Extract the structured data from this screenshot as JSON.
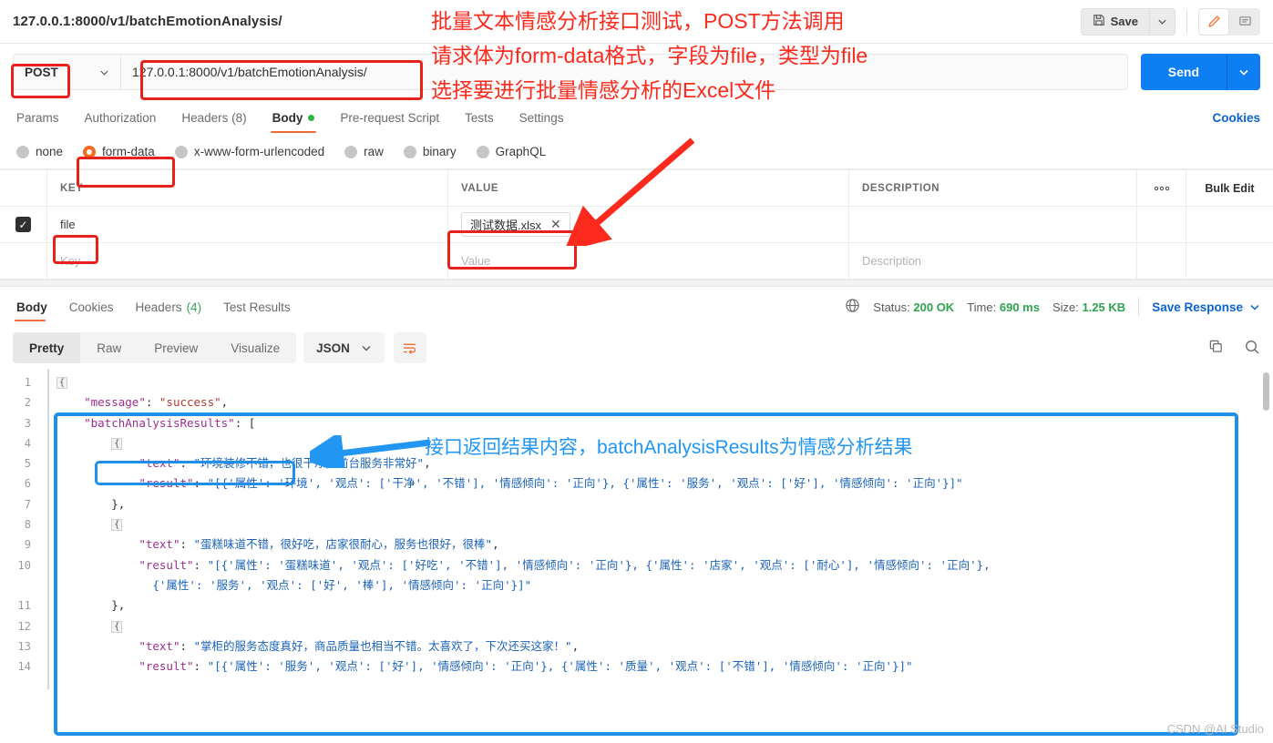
{
  "header": {
    "request_title": "127.0.0.1:8000/v1/batchEmotionAnalysis/",
    "save_label": "Save"
  },
  "url_bar": {
    "method": "POST",
    "url": "127.0.0.1:8000/v1/batchEmotionAnalysis/",
    "send_label": "Send"
  },
  "request_tabs": [
    {
      "label": "Params",
      "active": false
    },
    {
      "label": "Authorization",
      "active": false
    },
    {
      "label": "Headers (8)",
      "active": false
    },
    {
      "label": "Body",
      "active": true
    },
    {
      "label": "Pre-request Script",
      "active": false
    },
    {
      "label": "Tests",
      "active": false
    },
    {
      "label": "Settings",
      "active": false
    }
  ],
  "cookies_link": "Cookies",
  "body_types": [
    {
      "label": "none",
      "selected": false
    },
    {
      "label": "form-data",
      "selected": true
    },
    {
      "label": "x-www-form-urlencoded",
      "selected": false
    },
    {
      "label": "raw",
      "selected": false
    },
    {
      "label": "binary",
      "selected": false
    },
    {
      "label": "GraphQL",
      "selected": false
    }
  ],
  "kv_table": {
    "columns": {
      "key": "KEY",
      "value": "VALUE",
      "description": "DESCRIPTION"
    },
    "bulk_edit": "Bulk Edit",
    "rows": [
      {
        "checked": true,
        "key": "file",
        "value": "测试数据.xlsx",
        "value_is_file": true,
        "description": ""
      }
    ],
    "placeholders": {
      "key": "Key",
      "value": "Value",
      "description": "Description"
    }
  },
  "response": {
    "tabs": [
      {
        "label": "Body",
        "active": true
      },
      {
        "label": "Cookies",
        "active": false
      },
      {
        "label": "Headers",
        "count": "(4)",
        "active": false
      },
      {
        "label": "Test Results",
        "active": false
      }
    ],
    "status_label": "Status:",
    "status_value": "200 OK",
    "time_label": "Time:",
    "time_value": "690 ms",
    "size_label": "Size:",
    "size_value": "1.25 KB",
    "save_response": "Save Response",
    "view_modes": [
      {
        "label": "Pretty",
        "active": true
      },
      {
        "label": "Raw",
        "active": false
      },
      {
        "label": "Preview",
        "active": false
      },
      {
        "label": "Visualize",
        "active": false
      }
    ],
    "format": "JSON",
    "line_numbers": [
      1,
      2,
      3,
      4,
      5,
      6,
      7,
      8,
      9,
      10,
      11,
      12,
      13,
      14
    ],
    "body_lines": [
      {
        "n": 1,
        "indent": 0,
        "parts": [
          {
            "t": "fold",
            "v": "{"
          }
        ]
      },
      {
        "n": 2,
        "indent": 2,
        "parts": [
          {
            "t": "key",
            "v": "\"message\""
          },
          {
            "t": "pl",
            "v": ": "
          },
          {
            "t": "str",
            "v": "\"success\""
          },
          {
            "t": "pl",
            "v": ","
          }
        ]
      },
      {
        "n": 3,
        "indent": 2,
        "parts": [
          {
            "t": "key",
            "v": "\"batchAnalysisResults\""
          },
          {
            "t": "pl",
            "v": ": ["
          }
        ]
      },
      {
        "n": 4,
        "indent": 4,
        "parts": [
          {
            "t": "fold",
            "v": "{"
          }
        ]
      },
      {
        "n": 5,
        "indent": 6,
        "parts": [
          {
            "t": "key",
            "v": "\"text\""
          },
          {
            "t": "pl",
            "v": ": "
          },
          {
            "t": "cn",
            "v": "\"环境装修不错，也很干净，前台服务非常好\""
          },
          {
            "t": "pl",
            "v": ","
          }
        ]
      },
      {
        "n": 6,
        "indent": 6,
        "parts": [
          {
            "t": "key",
            "v": "\"result\""
          },
          {
            "t": "pl",
            "v": ": "
          },
          {
            "t": "cn",
            "v": "\"[{'属性': '环境', '观点': ['干净', '不错'], '情感倾向': '正向'}, {'属性': '服务', '观点': ['好'], '情感倾向': '正向'}]\""
          }
        ]
      },
      {
        "n": 7,
        "indent": 4,
        "parts": [
          {
            "t": "pl",
            "v": "},"
          }
        ]
      },
      {
        "n": 8,
        "indent": 4,
        "parts": [
          {
            "t": "fold",
            "v": "{"
          }
        ]
      },
      {
        "n": 9,
        "indent": 6,
        "parts": [
          {
            "t": "key",
            "v": "\"text\""
          },
          {
            "t": "pl",
            "v": ": "
          },
          {
            "t": "cn",
            "v": "\"蛋糕味道不错，很好吃，店家很耐心，服务也很好，很棒\""
          },
          {
            "t": "pl",
            "v": ","
          }
        ]
      },
      {
        "n": 10,
        "indent": 6,
        "wrapped": true,
        "parts": [
          {
            "t": "key",
            "v": "\"result\""
          },
          {
            "t": "pl",
            "v": ": "
          },
          {
            "t": "cn",
            "v": "\"[{'属性': '蛋糕味道', '观点': ['好吃', '不错'], '情感倾向': '正向'}, {'属性': '店家', '观点': ['耐心'], '情感倾向': '正向'},"
          }
        ],
        "parts2": [
          {
            "t": "cn",
            "v": "{'属性': '服务', '观点': ['好', '棒'], '情感倾向': '正向'}]\""
          }
        ]
      },
      {
        "n": 11,
        "indent": 4,
        "parts": [
          {
            "t": "pl",
            "v": "},"
          }
        ]
      },
      {
        "n": 12,
        "indent": 4,
        "parts": [
          {
            "t": "fold",
            "v": "{"
          }
        ]
      },
      {
        "n": 13,
        "indent": 6,
        "parts": [
          {
            "t": "key",
            "v": "\"text\""
          },
          {
            "t": "pl",
            "v": ": "
          },
          {
            "t": "cn",
            "v": "\"掌柜的服务态度真好，商品质量也相当不错。太喜欢了，下次还买这家！\""
          },
          {
            "t": "pl",
            "v": ","
          }
        ]
      },
      {
        "n": 14,
        "indent": 6,
        "parts": [
          {
            "t": "key",
            "v": "\"result\""
          },
          {
            "t": "pl",
            "v": ": "
          },
          {
            "t": "cn",
            "v": "\"[{'属性': '服务', '观点': ['好'], '情感倾向': '正向'}, {'属性': '质量', '观点': ['不错'], '情感倾向': '正向'}]\""
          }
        ]
      }
    ]
  },
  "annotations": {
    "red_line_1": "批量文本情感分析接口测试，POST方法调用",
    "red_line_2": "请求体为form-data格式，字段为file，类型为file",
    "red_line_3": "选择要进行批量情感分析的Excel文件",
    "blue_line_1": "接口返回结果内容，batchAnalysisResults为情感分析结果"
  },
  "watermark": "CSDN @AI Studio",
  "colors": {
    "red": "#fb2a1d",
    "blue": "#2196f3",
    "accent_orange": "#ef6c37",
    "send_blue": "#0d7ff2",
    "status_green": "#2fa34f"
  }
}
